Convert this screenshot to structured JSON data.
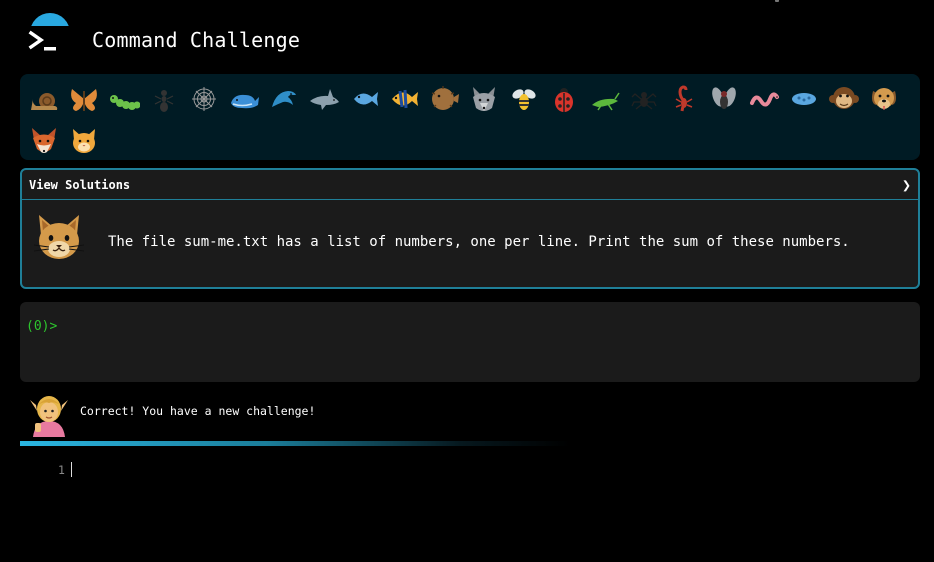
{
  "header": {
    "title": "Command Challenge",
    "logo_icon": "terminal-icon",
    "accent": "#29a8e0"
  },
  "animals": [
    {
      "name": "snail-icon"
    },
    {
      "name": "butterfly-icon"
    },
    {
      "name": "caterpillar-icon"
    },
    {
      "name": "ant-icon"
    },
    {
      "name": "spider-web-icon"
    },
    {
      "name": "whale-icon"
    },
    {
      "name": "dolphin-icon"
    },
    {
      "name": "shark-icon"
    },
    {
      "name": "fish-icon"
    },
    {
      "name": "tropical-fish-icon"
    },
    {
      "name": "blowfish-icon"
    },
    {
      "name": "wolf-icon"
    },
    {
      "name": "bee-icon"
    },
    {
      "name": "ladybug-icon"
    },
    {
      "name": "cricket-icon"
    },
    {
      "name": "spider-icon"
    },
    {
      "name": "scorpion-icon"
    },
    {
      "name": "fly-icon"
    },
    {
      "name": "worm-icon"
    },
    {
      "name": "microbe-icon"
    },
    {
      "name": "monkey-icon"
    },
    {
      "name": "dog-icon"
    },
    {
      "name": "fox-icon"
    },
    {
      "name": "cat-icon"
    }
  ],
  "challenge": {
    "view_solutions_label": "View Solutions",
    "chevron": "❯",
    "text": "The file sum-me.txt has a list of numbers, one per line. Print the sum of these numbers.",
    "avatar_icon": "cat-icon"
  },
  "terminal": {
    "prompt": "(0)>",
    "prompt_color": "#2dc62d"
  },
  "feedback": {
    "avatar_icon": "elf-icon",
    "message": "Correct! You have a new challenge!"
  },
  "editor": {
    "line_number": "1"
  }
}
